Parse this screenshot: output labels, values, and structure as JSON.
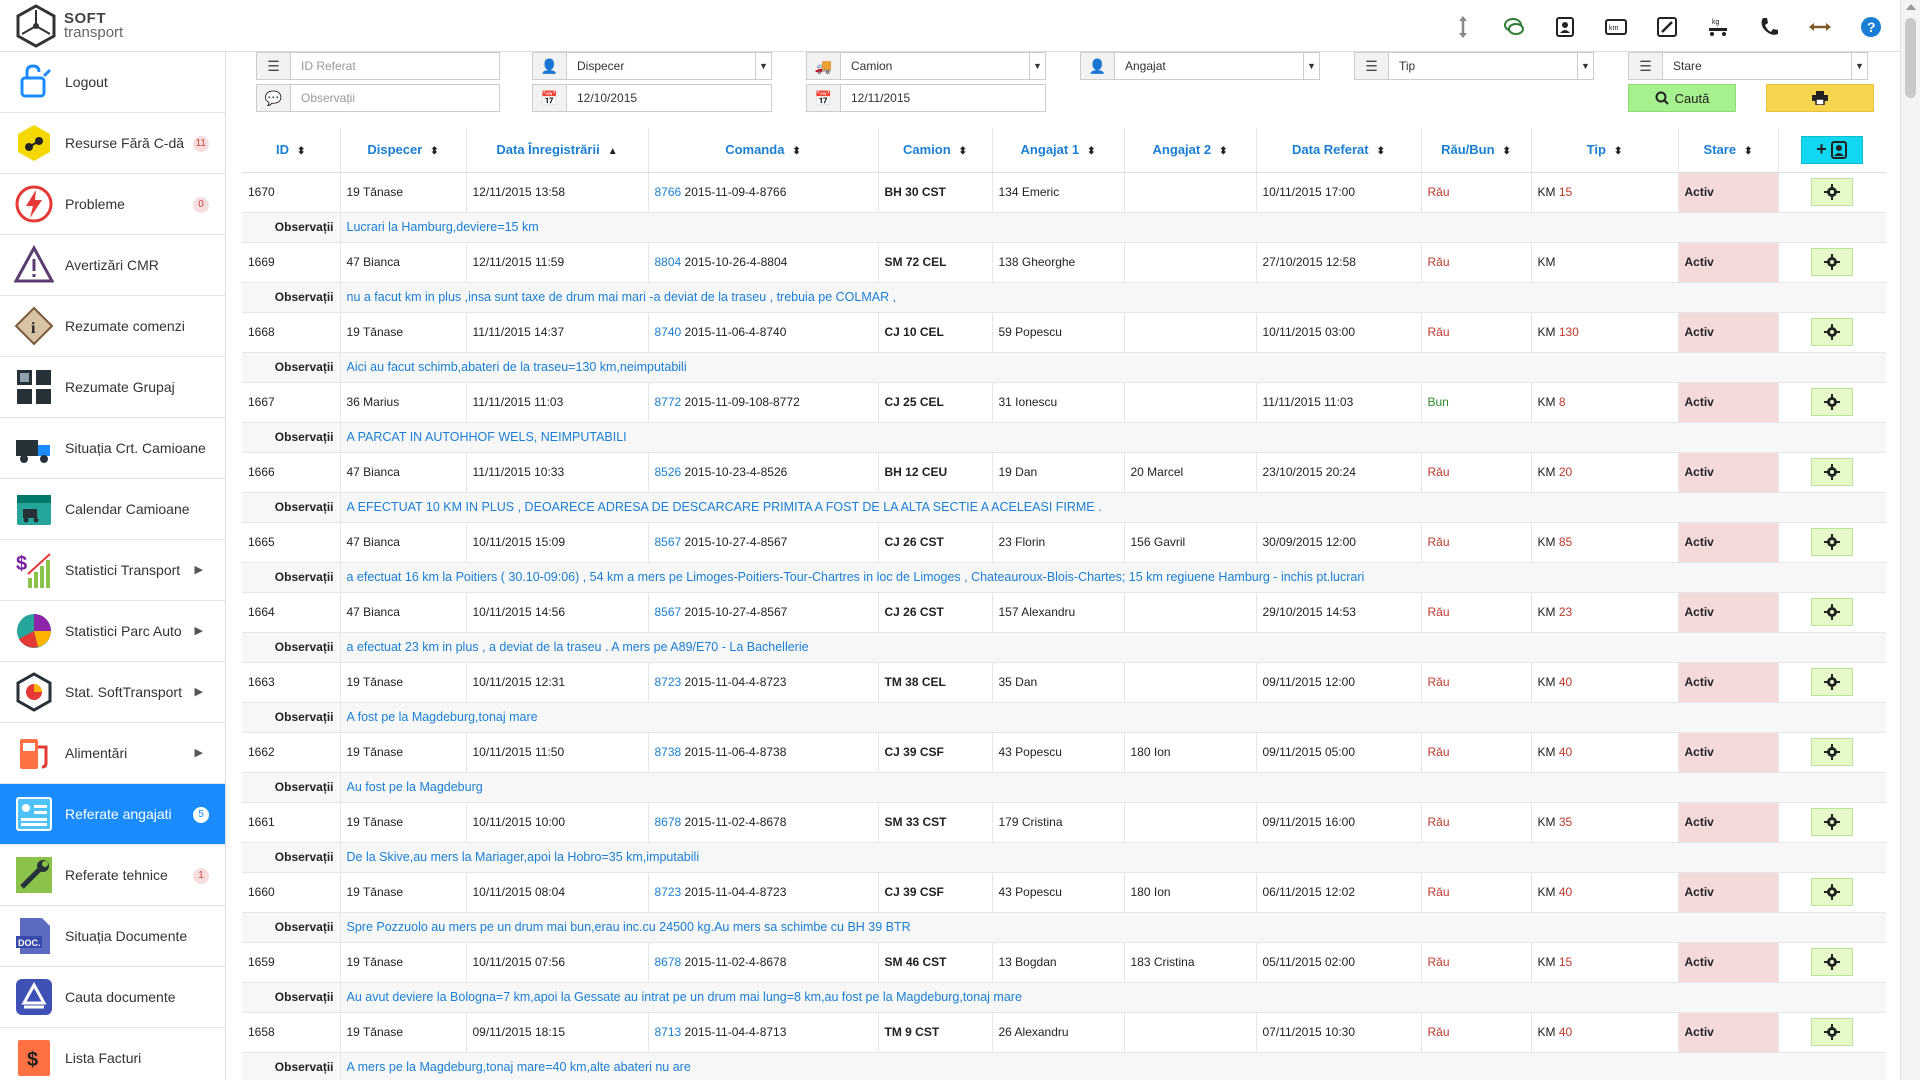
{
  "app": {
    "logo_line1": "SOFT",
    "logo_line2": "transport"
  },
  "header_icons": [
    "resize-vertical-icon",
    "chat-icon",
    "contact-card-icon",
    "kilometers-icon",
    "tools-icon",
    "weight-kg-icon",
    "phone-icon",
    "resize-horizontal-icon",
    "help-icon"
  ],
  "sidebar": {
    "items": [
      {
        "label": "Logout",
        "icon": "logout-icon",
        "badge": "",
        "chevron": false,
        "active": false
      },
      {
        "label": "Resurse Fără C-dă",
        "icon": "resources-icon",
        "badge": "11",
        "chevron": false,
        "active": false
      },
      {
        "label": "Probleme",
        "icon": "lightning-icon",
        "badge": "0",
        "chevron": false,
        "active": false
      },
      {
        "label": "Avertizări CMR",
        "icon": "warning-icon",
        "badge": "",
        "chevron": false,
        "active": false
      },
      {
        "label": "Rezumate comenzi",
        "icon": "info-diamond-icon",
        "badge": "",
        "chevron": false,
        "active": false
      },
      {
        "label": "Rezumate Grupaj",
        "icon": "grid-icon",
        "badge": "",
        "chevron": false,
        "active": false
      },
      {
        "label": "Situația Crt. Camioane",
        "icon": "truck-icon",
        "badge": "",
        "chevron": false,
        "active": false
      },
      {
        "label": "Calendar Camioane",
        "icon": "calendar-truck-icon",
        "badge": "",
        "chevron": false,
        "active": false
      },
      {
        "label": "Statistici Transport",
        "icon": "dollar-chart-icon",
        "badge": "",
        "chevron": true,
        "active": false
      },
      {
        "label": "Statistici Parc Auto",
        "icon": "pie-chart-icon",
        "badge": "",
        "chevron": true,
        "active": false
      },
      {
        "label": "Stat. SoftTransport",
        "icon": "hexagon-stats-icon",
        "badge": "",
        "chevron": true,
        "active": false
      },
      {
        "label": "Alimentări",
        "icon": "fuel-pump-icon",
        "badge": "",
        "chevron": true,
        "active": false
      },
      {
        "label": "Referate angajati",
        "icon": "employee-report-icon",
        "badge": "5",
        "chevron": false,
        "active": true
      },
      {
        "label": "Referate tehnice",
        "icon": "wrench-icon",
        "badge": "1",
        "chevron": false,
        "active": false
      },
      {
        "label": "Situația Documente",
        "icon": "doc-icon",
        "badge": "",
        "chevron": false,
        "active": false
      },
      {
        "label": "Cauta documente",
        "icon": "drive-icon",
        "badge": "",
        "chevron": false,
        "active": false
      },
      {
        "label": "Lista Facturi",
        "icon": "invoice-icon",
        "badge": "",
        "chevron": false,
        "active": false
      }
    ]
  },
  "filters": {
    "id_referat_placeholder": "ID Referat",
    "observatii_placeholder": "Observații",
    "dispecer": "Dispecer",
    "date_from": "12/10/2015",
    "camion": "Camion",
    "date_to": "12/11/2015",
    "angajat": "Angajat",
    "tip": "Tip",
    "stare": "Stare",
    "search_label": "Caută"
  },
  "table": {
    "columns": [
      "ID",
      "Dispecer",
      "Data Înregistrării",
      "Comanda",
      "Camion",
      "Angajat 1",
      "Angajat 2",
      "Data Referat",
      "Rău/Bun",
      "Tip",
      "Stare"
    ],
    "obs_label": "Observații",
    "rows": [
      {
        "id": "1670",
        "dispecer": "19 Tănase",
        "data_inreg": "12/11/2015 13:58",
        "cmd_id": "8766",
        "cmd_code": "2015-11-09-4-8766",
        "camion": "BH 30 CST",
        "angajat1": "134 Emeric",
        "angajat2": "",
        "data_referat": "10/11/2015 17:00",
        "rau_bun": "Rău",
        "tip": "KM",
        "km": "15",
        "stare": "Activ",
        "obs": "Lucrari la Hamburg,deviere=15 km"
      },
      {
        "id": "1669",
        "dispecer": "47 Bianca",
        "data_inreg": "12/11/2015 11:59",
        "cmd_id": "8804",
        "cmd_code": "2015-10-26-4-8804",
        "camion": "SM 72 CEL",
        "angajat1": "138 Gheorghe",
        "angajat2": "",
        "data_referat": "27/10/2015 12:58",
        "rau_bun": "Rău",
        "tip": "KM",
        "km": "",
        "stare": "Activ",
        "obs": "nu a facut km in plus ,insa sunt taxe de drum mai mari -a deviat de la traseu , trebuia pe COLMAR ,"
      },
      {
        "id": "1668",
        "dispecer": "19 Tănase",
        "data_inreg": "11/11/2015 14:37",
        "cmd_id": "8740",
        "cmd_code": "2015-11-06-4-8740",
        "camion": "CJ 10 CEL",
        "angajat1": "59 Popescu",
        "angajat2": "",
        "data_referat": "10/11/2015 03:00",
        "rau_bun": "Rău",
        "tip": "KM",
        "km": "130",
        "stare": "Activ",
        "obs": "Aici au facut schimb,abateri de la traseu=130 km,neimputabili"
      },
      {
        "id": "1667",
        "dispecer": "36 Marius",
        "data_inreg": "11/11/2015 11:03",
        "cmd_id": "8772",
        "cmd_code": "2015-11-09-108-8772",
        "camion": "CJ 25 CEL",
        "angajat1": "31 Ionescu",
        "angajat2": "",
        "data_referat": "11/11/2015 11:03",
        "rau_bun": "Bun",
        "tip": "KM",
        "km": "8",
        "stare": "Activ",
        "obs": "A PARCAT IN AUTOHHOF WELS, NEIMPUTABILI"
      },
      {
        "id": "1666",
        "dispecer": "47 Bianca",
        "data_inreg": "11/11/2015 10:33",
        "cmd_id": "8526",
        "cmd_code": "2015-10-23-4-8526",
        "camion": "BH 12 CEU",
        "angajat1": "19 Dan",
        "angajat2": "20 Marcel",
        "data_referat": "23/10/2015 20:24",
        "rau_bun": "Rău",
        "tip": "KM",
        "km": "20",
        "stare": "Activ",
        "obs": "A EFECTUAT 10 KM IN PLUS , DEOARECE ADRESA DE DESCARCARE PRIMITA A FOST DE LA ALTA SECTIE A ACELEASI FIRME ."
      },
      {
        "id": "1665",
        "dispecer": "47 Bianca",
        "data_inreg": "10/11/2015 15:09",
        "cmd_id": "8567",
        "cmd_code": "2015-10-27-4-8567",
        "camion": "CJ 26 CST",
        "angajat1": "23 Florin",
        "angajat2": "156 Gavril",
        "data_referat": "30/09/2015 12:00",
        "rau_bun": "Rău",
        "tip": "KM",
        "km": "85",
        "stare": "Activ",
        "obs": "a efectuat 16 km la Poitiers ( 30.10-09:06) , 54 km a mers pe Limoges-Poitiers-Tour-Chartres in loc de Limoges , Chateauroux-Blois-Chartes; 15 km regiuene Hamburg - inchis pt.lucrari"
      },
      {
        "id": "1664",
        "dispecer": "47 Bianca",
        "data_inreg": "10/11/2015 14:56",
        "cmd_id": "8567",
        "cmd_code": "2015-10-27-4-8567",
        "camion": "CJ 26 CST",
        "angajat1": "157 Alexandru",
        "angajat2": "",
        "data_referat": "29/10/2015 14:53",
        "rau_bun": "Rău",
        "tip": "KM",
        "km": "23",
        "stare": "Activ",
        "obs": "a efectuat 23 km in plus , a deviat de la traseu . A mers pe A89/E70 - La Bachellerie"
      },
      {
        "id": "1663",
        "dispecer": "19 Tănase",
        "data_inreg": "10/11/2015 12:31",
        "cmd_id": "8723",
        "cmd_code": "2015-11-04-4-8723",
        "camion": "TM 38 CEL",
        "angajat1": "35 Dan",
        "angajat2": "",
        "data_referat": "09/11/2015 12:00",
        "rau_bun": "Rău",
        "tip": "KM",
        "km": "40",
        "stare": "Activ",
        "obs": "A fost pe la Magdeburg,tonaj mare"
      },
      {
        "id": "1662",
        "dispecer": "19 Tănase",
        "data_inreg": "10/11/2015 11:50",
        "cmd_id": "8738",
        "cmd_code": "2015-11-06-4-8738",
        "camion": "CJ 39 CSF",
        "angajat1": "43 Popescu",
        "angajat2": "180 Ion",
        "data_referat": "09/11/2015 05:00",
        "rau_bun": "Rău",
        "tip": "KM",
        "km": "40",
        "stare": "Activ",
        "obs": "Au fost pe la Magdeburg"
      },
      {
        "id": "1661",
        "dispecer": "19 Tănase",
        "data_inreg": "10/11/2015 10:00",
        "cmd_id": "8678",
        "cmd_code": "2015-11-02-4-8678",
        "camion": "SM 33 CST",
        "angajat1": "179 Cristina",
        "angajat2": "",
        "data_referat": "09/11/2015 16:00",
        "rau_bun": "Rău",
        "tip": "KM",
        "km": "35",
        "stare": "Activ",
        "obs": "De la Skive,au mers la Mariager,apoi la Hobro=35 km,imputabili"
      },
      {
        "id": "1660",
        "dispecer": "19 Tănase",
        "data_inreg": "10/11/2015 08:04",
        "cmd_id": "8723",
        "cmd_code": "2015-11-04-4-8723",
        "camion": "CJ 39 CSF",
        "angajat1": "43 Popescu",
        "angajat2": "180 Ion",
        "data_referat": "06/11/2015 12:02",
        "rau_bun": "Rău",
        "tip": "KM",
        "km": "40",
        "stare": "Activ",
        "obs": "Spre Pozzuolo au mers pe un drum mai bun,erau inc.cu 24500 kg.Au mers sa schimbe cu BH 39 BTR"
      },
      {
        "id": "1659",
        "dispecer": "19 Tănase",
        "data_inreg": "10/11/2015 07:56",
        "cmd_id": "8678",
        "cmd_code": "2015-11-02-4-8678",
        "camion": "SM 46 CST",
        "angajat1": "13 Bogdan",
        "angajat2": "183 Cristina",
        "data_referat": "05/11/2015 02:00",
        "rau_bun": "Rău",
        "tip": "KM",
        "km": "15",
        "stare": "Activ",
        "obs": "Au avut deviere la Bologna=7 km,apoi la Gessate au intrat pe un drum mai lung=8 km,au fost pe la Magdeburg,tonaj mare"
      },
      {
        "id": "1658",
        "dispecer": "19 Tănase",
        "data_inreg": "09/11/2015 18:15",
        "cmd_id": "8713",
        "cmd_code": "2015-11-04-4-8713",
        "camion": "TM 9 CST",
        "angajat1": "26 Alexandru",
        "angajat2": "",
        "data_referat": "07/11/2015 10:30",
        "rau_bun": "Rău",
        "tip": "KM",
        "km": "40",
        "stare": "Activ",
        "obs": "A mers pe la Magdeburg,tonaj mare=40 km,alte abateri nu are"
      }
    ]
  }
}
